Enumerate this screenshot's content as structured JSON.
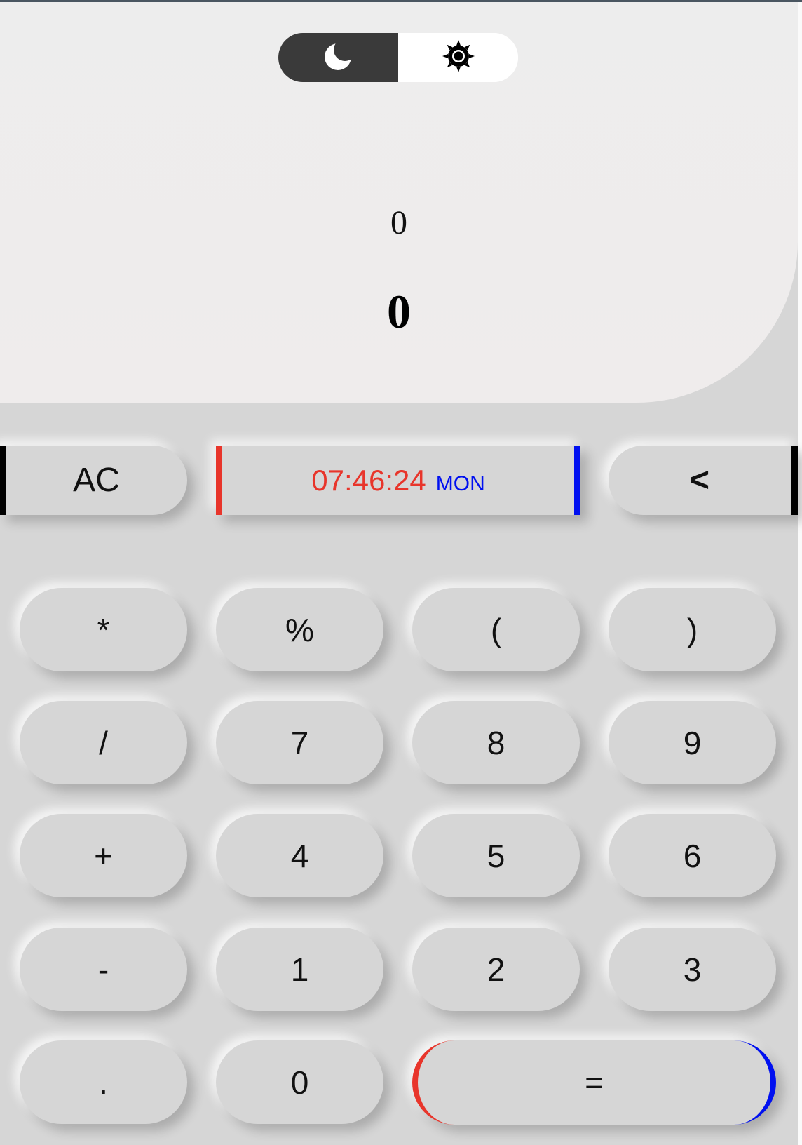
{
  "theme_toggle": {
    "dark_icon": "moon-icon",
    "light_icon": "sun-icon",
    "active": "light"
  },
  "display": {
    "expression": "0",
    "result": "0"
  },
  "controls": {
    "clear_label": "AC",
    "backspace_label": "<"
  },
  "clock": {
    "time": "07:46:24",
    "day": "MON"
  },
  "keypad": {
    "row1": [
      "*",
      "%",
      "(",
      ")"
    ],
    "row2": [
      "/",
      "7",
      "8",
      "9"
    ],
    "row3": [
      "+",
      "4",
      "5",
      "6"
    ],
    "row4": [
      "-",
      "1",
      "2",
      "3"
    ],
    "row5": [
      ".",
      "0",
      "="
    ]
  },
  "colors": {
    "background": "#d6d6d6",
    "display_background": "#efecec",
    "accent_red": "#e8352b",
    "accent_blue": "#0010f0",
    "toggle_dark": "#3a3a3a"
  }
}
